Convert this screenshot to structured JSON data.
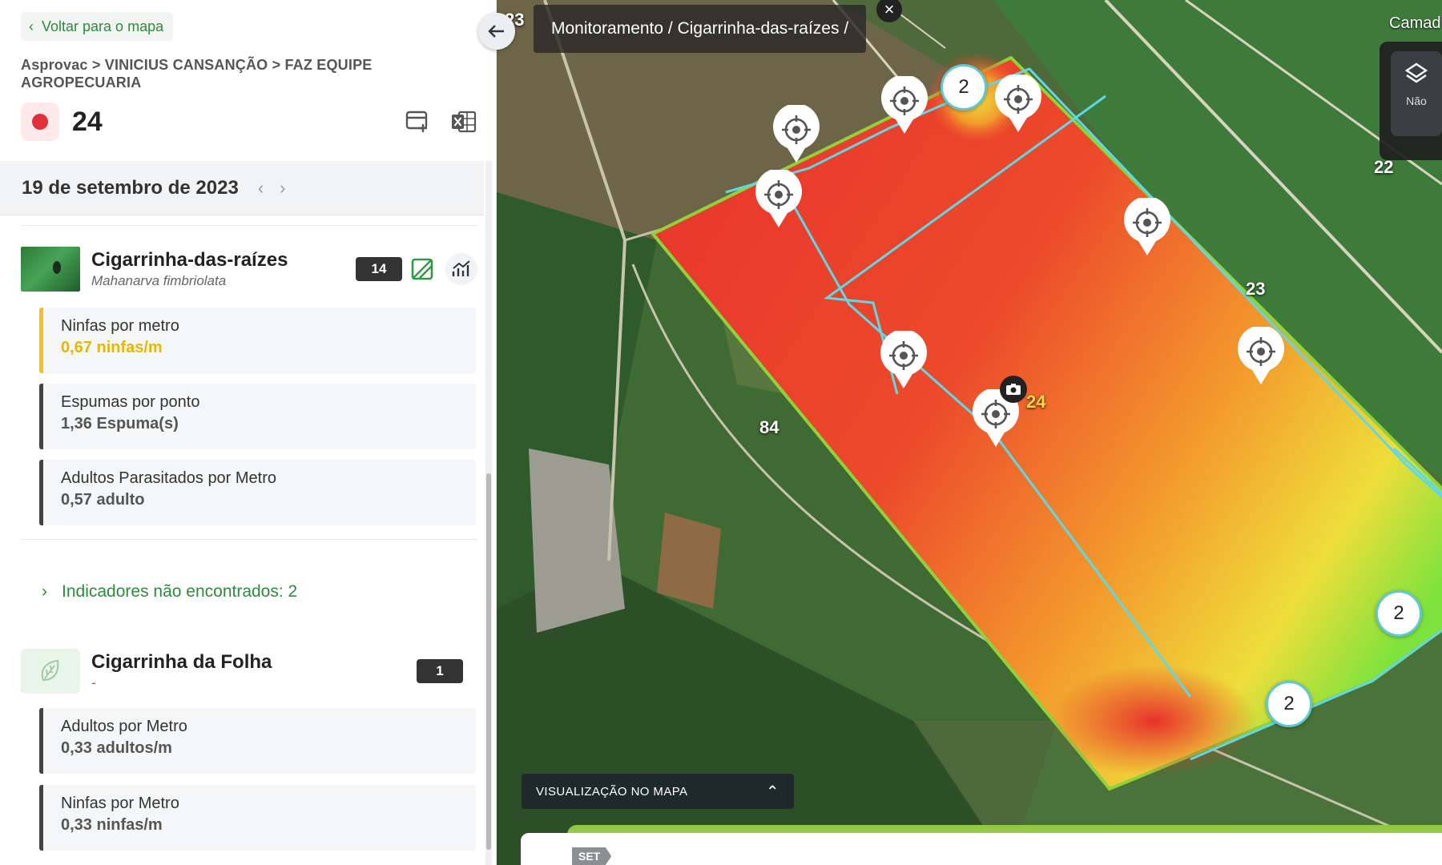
{
  "sidebar": {
    "back_label": "Voltar para o mapa",
    "breadcrumb": "Asprovac > VINICIUS CANSANÇÃO > FAZ EQUIPE AGROPECUARIA",
    "plot_number": "24",
    "status_color": "#e0313a",
    "action_icons": [
      "add-layout-icon",
      "excel-export-icon"
    ],
    "date": "19 de setembro de 2023",
    "pests": [
      {
        "name": "Cigarrinha-das-raízes",
        "scientific": "Mahanarva fimbriolata",
        "count": "14",
        "icons": [
          "map-heat-icon",
          "chart-icon"
        ],
        "metrics": [
          {
            "label": "Ninfas por metro",
            "value": "0,67 ninfas/m",
            "level": "warning",
            "color": "#f0c419"
          },
          {
            "label": "Espumas por ponto",
            "value": "1,36 Espuma(s)",
            "level": "neutral",
            "color": "#444444"
          },
          {
            "label": "Adultos Parasitados por Metro",
            "value": "0,57 adulto",
            "level": "neutral",
            "color": "#444444"
          }
        ]
      },
      {
        "name": "Cigarrinha da Folha",
        "scientific": "-",
        "count": "1",
        "metrics": [
          {
            "label": "Adultos por Metro",
            "value": "0,33 adultos/m",
            "level": "neutral",
            "color": "#444444"
          },
          {
            "label": "Ninfas por Metro",
            "value": "0,33 ninfas/m",
            "level": "neutral",
            "color": "#444444"
          }
        ]
      }
    ],
    "not_found": "Indicadores não encontrados: 2"
  },
  "map": {
    "breadcrumb": "Monitoramento / Cigarrinha-das-raízes /",
    "layers_label": "Camad",
    "layers_sub": "Não",
    "labels": [
      {
        "id": "23-top",
        "text": "23"
      },
      {
        "id": "22",
        "text": "22"
      },
      {
        "id": "23",
        "text": "23"
      },
      {
        "id": "84",
        "text": "84"
      },
      {
        "id": "24",
        "text": "24"
      }
    ],
    "clusters": [
      "2",
      "2",
      "2"
    ],
    "visualization_label": "VISUALIZAÇÃO NO MAPA",
    "timeline_tag": "SET",
    "heat_colors": {
      "high": "#e8322c",
      "mid": "#f39a2c",
      "low": "#7ee23c"
    }
  }
}
